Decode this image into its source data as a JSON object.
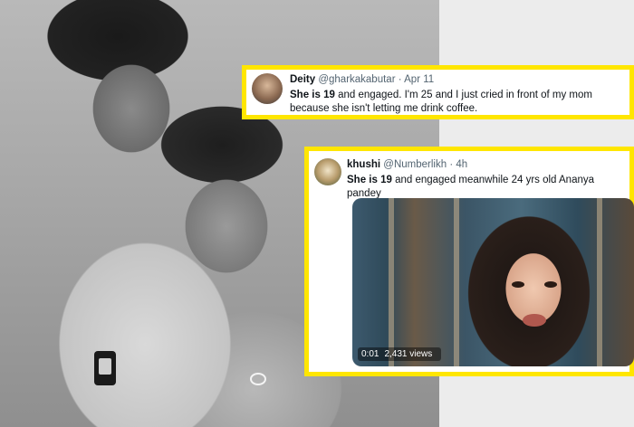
{
  "tweet1": {
    "name": "Deity",
    "handle": "@gharkakabutar",
    "sep": "·",
    "time": "Apr 11",
    "bold": "She is 19",
    "rest": " and engaged. I'm 25 and I just cried in front of my mom because she isn't letting me drink coffee."
  },
  "tweet2": {
    "name": "khushi",
    "handle": "@Numberlikh",
    "sep": "·",
    "time": "4h",
    "bold": "She is 19",
    "rest": " and engaged meanwhile 24 yrs old Ananya pandey",
    "video": {
      "time": "0:01",
      "views": "2,431 views"
    }
  },
  "colors": {
    "highlight_border": "#ffe600",
    "text": "#0f1419",
    "muted": "#536471"
  }
}
